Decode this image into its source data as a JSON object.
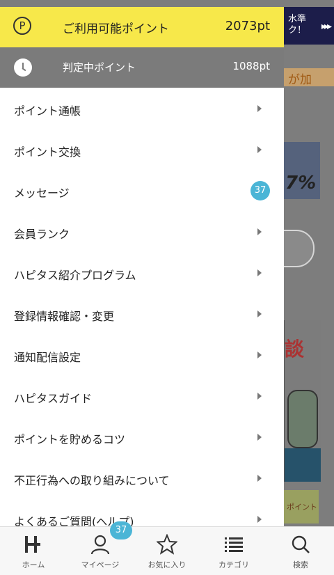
{
  "background": {
    "top_banner_text_line1": "水準",
    "top_banner_text_line2": "ク！",
    "top_banner_arrows": "▸▸▸",
    "orange_link_text": "が加",
    "banner_percent": "7%",
    "ad_kanji": "談",
    "small_banner_text": "ポイント"
  },
  "points": {
    "available_label": "ご利用可能ポイント",
    "available_value": "2073pt",
    "pending_label": "判定中ポイント",
    "pending_value": "1088pt",
    "coin_letter": "P"
  },
  "menu": [
    {
      "label": "ポイント通帳"
    },
    {
      "label": "ポイント交換"
    },
    {
      "label": "メッセージ",
      "badge": "37"
    },
    {
      "label": "会員ランク"
    },
    {
      "label": "ハピタス紹介プログラム"
    },
    {
      "label": "登録情報確認・変更"
    },
    {
      "label": "通知配信設定"
    },
    {
      "label": "ハピタスガイド"
    },
    {
      "label": "ポイントを貯めるコツ"
    },
    {
      "label": "不正行為への取り組みについて"
    },
    {
      "label": "よくあるご質問(ヘルプ)"
    }
  ],
  "tabbar": {
    "tabs": [
      {
        "label": "ホーム",
        "icon": "home-logo-icon"
      },
      {
        "label": "マイページ",
        "icon": "person-icon"
      },
      {
        "label": "お気に入り",
        "icon": "star-icon"
      },
      {
        "label": "カテゴリ",
        "icon": "list-icon"
      },
      {
        "label": "検索",
        "icon": "search-icon"
      }
    ],
    "mypage_badge": "37"
  },
  "colors": {
    "points_bar": "#f7e84a",
    "pending_bar": "#7b7b7b",
    "badge": "#4bb5d6"
  }
}
